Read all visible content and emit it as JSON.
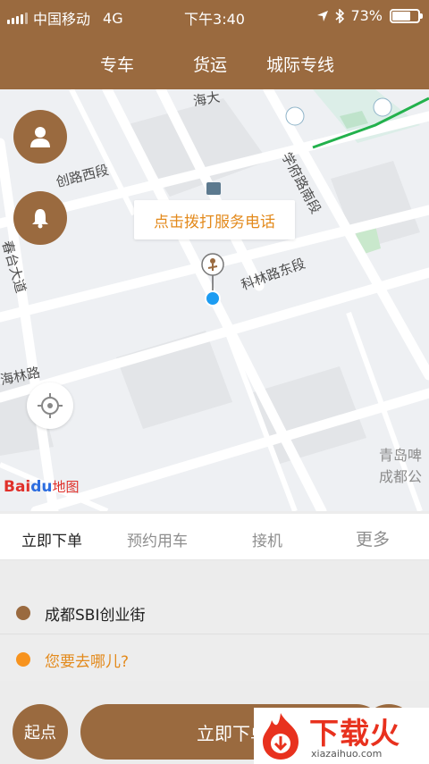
{
  "status_bar": {
    "carrier": "中国移动",
    "network": "4G",
    "time": "下午3:40",
    "battery_text": "73%",
    "battery_level": 0.73
  },
  "top_tabs": [
    "专车",
    "货运",
    "城际专线"
  ],
  "map": {
    "road_labels": {
      "r1": "海大",
      "r2": "创路西段",
      "r3": "学府路南段",
      "r4": "科林路东段",
      "r5": "春台大道",
      "r6": "海林路",
      "r7": "青岛啤",
      "r8": "成都公"
    },
    "tooltip": "点击拨打服务电话",
    "logo": {
      "bai": "Bai",
      "du": "du",
      "text": "地图"
    },
    "colors": {
      "accent": "#9a6a3f",
      "tooltip_text": "#e38a1c",
      "location_dot": "#1c9cf2",
      "route_line": "#22b14c"
    }
  },
  "ride_tabs": [
    "立即下单",
    "预约用车",
    "接机",
    "更多"
  ],
  "start_address": "成都SBI创业街",
  "destination_placeholder": "您要去哪儿?",
  "buttons": {
    "start": "起点",
    "order": "立即下单"
  },
  "watermark": {
    "text": "下载火",
    "url": "xiazaihuo.com"
  }
}
